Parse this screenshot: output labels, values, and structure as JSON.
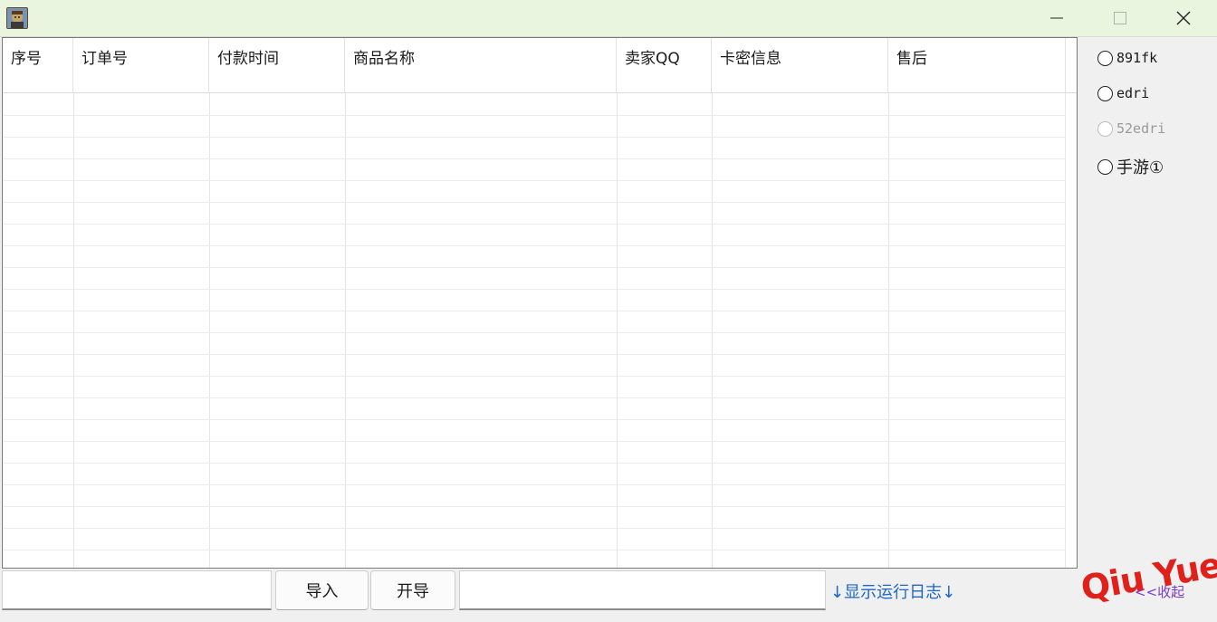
{
  "window": {
    "minimize_glyph": "—",
    "maximize_glyph": "☐",
    "close_glyph": "✕"
  },
  "grid": {
    "columns": [
      "序号",
      "订单号",
      "付款时间",
      "商品名称",
      "卖家QQ",
      "卡密信息",
      "售后"
    ],
    "empty_rows": 21
  },
  "sources": [
    {
      "label": "891fk",
      "enabled": true,
      "selected": false
    },
    {
      "label": "edri",
      "enabled": true,
      "selected": false
    },
    {
      "label": "52edri",
      "enabled": false,
      "selected": false
    },
    {
      "label": "手游①",
      "enabled": true,
      "selected": false
    }
  ],
  "toolbar": {
    "left_input_value": "",
    "import_label": "导入",
    "export_label": "开导",
    "right_input_value": "",
    "show_log_label": "↓显示运行日志↓",
    "collapse_label": "<<收起"
  },
  "watermark": "Qiu Yue",
  "colors": {
    "titlebar": "#eaf5e0",
    "link": "#1e66c8",
    "watermark": "#e0201a"
  }
}
